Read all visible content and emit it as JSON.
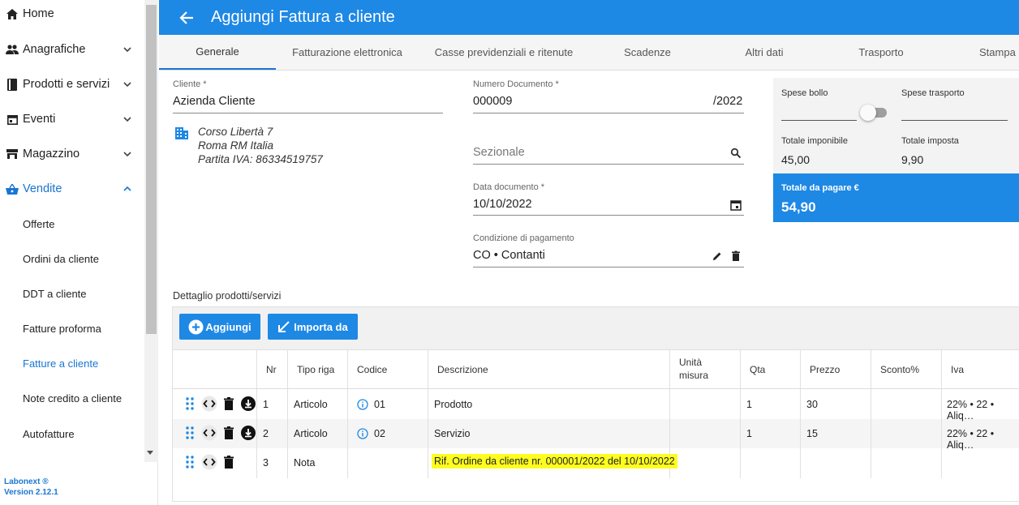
{
  "sidebar": {
    "items": [
      {
        "label": "Home",
        "icon": "home-icon"
      },
      {
        "label": "Anagrafiche",
        "icon": "people-icon"
      },
      {
        "label": "Prodotti e servizi",
        "icon": "book-icon"
      },
      {
        "label": "Eventi",
        "icon": "calendar-icon"
      },
      {
        "label": "Magazzino",
        "icon": "warehouse-icon"
      },
      {
        "label": "Vendite",
        "icon": "basket-icon"
      }
    ],
    "sub_items": [
      {
        "label": "Offerte"
      },
      {
        "label": "Ordini da cliente"
      },
      {
        "label": "DDT a cliente"
      },
      {
        "label": "Fatture proforma"
      },
      {
        "label": "Fatture a cliente"
      },
      {
        "label": "Note credito a cliente"
      },
      {
        "label": "Autofatture"
      }
    ],
    "brand": "Labonext ®",
    "version": "Version 2.12.1"
  },
  "header": {
    "title": "Aggiungi Fattura a cliente"
  },
  "tabs": [
    {
      "label": "Generale"
    },
    {
      "label": "Fatturazione elettronica"
    },
    {
      "label": "Casse previdenziali e ritenute"
    },
    {
      "label": "Scadenze"
    },
    {
      "label": "Altri dati"
    },
    {
      "label": "Trasporto"
    },
    {
      "label": "Stampa"
    }
  ],
  "form": {
    "cliente_label": "Cliente *",
    "cliente_value": "Azienda Cliente",
    "address_line1": "Corso Libertà 7",
    "address_line2": "Roma RM Italia",
    "address_line3": "Partita IVA: 86334519757",
    "numero_label": "Numero Documento *",
    "numero_value": "000009",
    "numero_suffix": "/2022",
    "sezionale_placeholder": "Sezionale",
    "data_label": "Data documento *",
    "data_value": "10/10/2022",
    "condizione_label": "Condizione di pagamento",
    "condizione_value": "CO • Contanti"
  },
  "totals": {
    "spese_bollo_label": "Spese bollo",
    "spese_trasporto_label": "Spese trasporto",
    "totale_imponibile_label": "Totale imponibile",
    "totale_imponibile_value": "45,00",
    "totale_imposta_label": "Totale imposta",
    "totale_imposta_value": "9,90",
    "totale_pagare_label": "Totale da pagare €",
    "totale_pagare_value": "54,90"
  },
  "details": {
    "title": "Dettaglio prodotti/servizi",
    "add_label": "Aggiungi",
    "import_label": "Importa da",
    "columns": {
      "nr": "Nr",
      "tipo": "Tipo riga",
      "codice": "Codice",
      "descrizione": "Descrizione",
      "unita1": "Unità",
      "unita2": "misura",
      "qta": "Qta",
      "prezzo": "Prezzo",
      "sconto": "Sconto%",
      "iva": "Iva"
    },
    "rows": [
      {
        "nr": "1",
        "tipo": "Articolo",
        "codice": "01",
        "descrizione": "Prodotto",
        "qta": "1",
        "prezzo": "30",
        "iva": "22% • 22 • Aliq…"
      },
      {
        "nr": "2",
        "tipo": "Articolo",
        "codice": "02",
        "descrizione": "Servizio",
        "qta": "1",
        "prezzo": "15",
        "iva": "22% • 22 • Aliq…"
      },
      {
        "nr": "3",
        "tipo": "Nota",
        "codice": "",
        "descrizione": "Rif. Ordine da cliente nr. 000001/2022 del 10/10/2022",
        "qta": "",
        "prezzo": "",
        "iva": ""
      }
    ]
  },
  "colors": {
    "primary": "#1e88e5",
    "active_text": "#1976d2",
    "highlight": "#fdfd20"
  }
}
